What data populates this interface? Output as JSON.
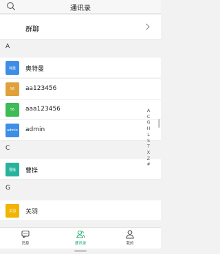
{
  "header": {
    "title": "通讯录",
    "search_icon": "search-icon"
  },
  "group_chat": {
    "label": "群聊",
    "chevron_icon": "chevron-right-icon"
  },
  "sections": [
    {
      "letter": "A",
      "contacts": [
        {
          "name": "奥特曼",
          "avatar_text": "特曼",
          "avatar_color": "#3d8ee6"
        },
        {
          "name": "aa123456",
          "avatar_text": "56",
          "avatar_color": "#e0a03a"
        },
        {
          "name": "aaa123456",
          "avatar_text": "56",
          "avatar_color": "#3dbb55"
        },
        {
          "name": "admin",
          "avatar_text": "admin",
          "avatar_color": "#3d8ee6"
        }
      ]
    },
    {
      "letter": "C",
      "contacts": [
        {
          "name": "曹操",
          "avatar_text": "曹操",
          "avatar_color": "#27b39b"
        }
      ]
    },
    {
      "letter": "G",
      "contacts": [
        {
          "name": "关羽",
          "avatar_text": "关羽",
          "avatar_color": "#f1b400"
        }
      ]
    }
  ],
  "index_letters": [
    "A",
    "C",
    "G",
    "H",
    "L",
    "S",
    "T",
    "X",
    "Z",
    "#"
  ],
  "tabs": [
    {
      "label": "消息",
      "icon": "message-icon",
      "active": false
    },
    {
      "label": "通讯录",
      "icon": "contacts-icon",
      "active": true
    },
    {
      "label": "我的",
      "icon": "profile-icon",
      "active": false
    }
  ],
  "colors": {
    "accent": "#1fae68"
  }
}
